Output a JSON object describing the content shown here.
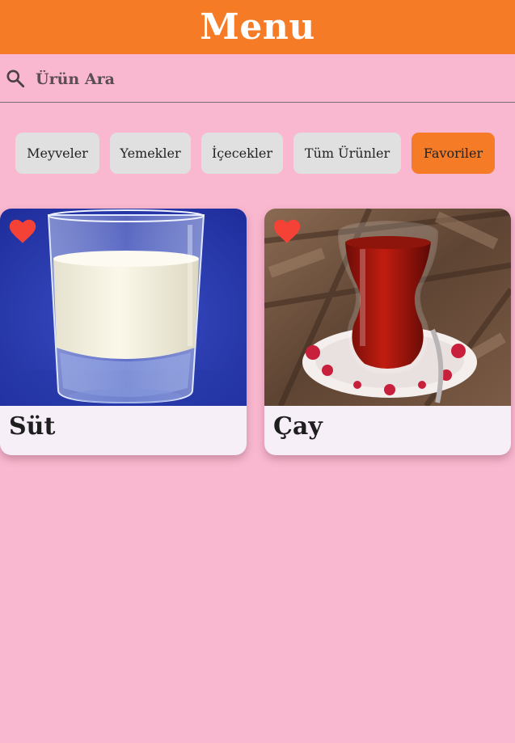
{
  "app_bar": {
    "title": "Menu",
    "color": "#f67b27"
  },
  "search": {
    "placeholder": "Ürün Ara",
    "value": "",
    "icon": "search-icon"
  },
  "categories": [
    {
      "label": "Meyveler",
      "active": false
    },
    {
      "label": "Yemekler",
      "active": false
    },
    {
      "label": "İçecekler",
      "active": false
    },
    {
      "label": "Tüm Ürünler",
      "active": false
    },
    {
      "label": "Favoriler",
      "active": true
    }
  ],
  "products": [
    {
      "name": "Süt",
      "favorite": true,
      "icon": "heart-icon"
    },
    {
      "name": "Çay",
      "favorite": true,
      "icon": "heart-icon"
    }
  ],
  "colors": {
    "background": "#f9b8cf",
    "accent": "#f67b27",
    "chip": "#e0e0e0",
    "heart": "#f44336",
    "card": "#f6eff8"
  }
}
